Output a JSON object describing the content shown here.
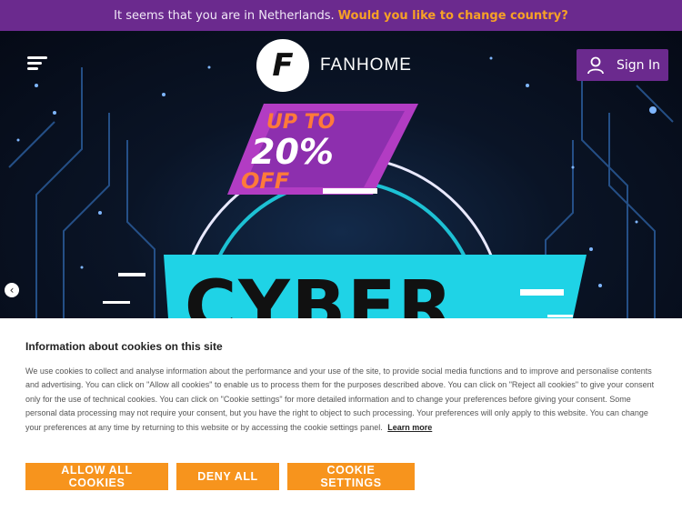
{
  "country_banner": {
    "message": "It seems that you are in Netherlands.",
    "action": "Would you like to change country?"
  },
  "header": {
    "logo_mark": "F",
    "logo_text": "FANHOME",
    "signin_label": "Sign In"
  },
  "hero": {
    "promo_line1": "UP TO",
    "promo_line2": "20%",
    "promo_line3": "OFF",
    "headline": "CYBER"
  },
  "cookie_notice": {
    "title": "Information about cookies on this site",
    "body": "We use cookies to collect and analyse information about the performance and your use of the site, to provide social media functions and to improve and personalise contents and advertising. You can click on \"Allow all cookies\" to enable us to process them for the purposes described above. You can click on \"Reject all cookies\" to give your consent only for the use of technical cookies. You can click on \"Cookie settings\" for more detailed information and to change your preferences before giving your consent. Some personal data processing may not require your consent, but you have the right to object to such processing. Your preferences will only apply to this website. You can change your preferences at any time by returning to this website or by accessing the cookie settings panel.",
    "learn_more": "Learn more",
    "allow_label": "ALLOW ALL COOKIES",
    "deny_label": "DENY ALL",
    "settings_label": "COOKIE SETTINGS"
  },
  "colors": {
    "brand_purple": "#6b2a8e",
    "accent_orange": "#f7941d",
    "promo_cyan": "#1fd3e6"
  },
  "icons": [
    "hamburger-menu-icon",
    "user-icon",
    "chevron-left-icon"
  ]
}
